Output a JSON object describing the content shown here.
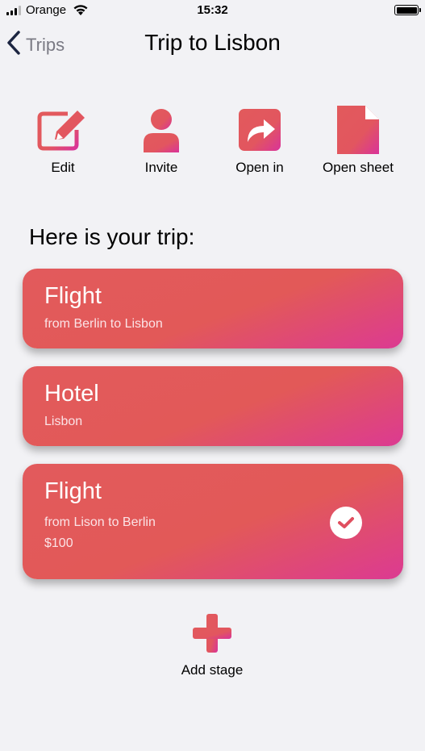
{
  "status_bar": {
    "carrier": "Orange",
    "time": "15:32"
  },
  "nav": {
    "back_label": "Trips",
    "title": "Trip to Lisbon"
  },
  "actions": [
    {
      "label": "Edit",
      "icon": "edit-icon"
    },
    {
      "label": "Invite",
      "icon": "person-icon"
    },
    {
      "label": "Open in",
      "icon": "share-icon"
    },
    {
      "label": "Open sheet",
      "icon": "document-icon"
    }
  ],
  "section_title": "Here is your trip:",
  "stages": [
    {
      "title": "Flight",
      "lines": [
        "from Berlin to Lisbon"
      ],
      "completed": false
    },
    {
      "title": "Hotel",
      "lines": [
        "Lisbon"
      ],
      "completed": false
    },
    {
      "title": "Flight",
      "lines": [
        "from Lison to Berlin",
        "$100"
      ],
      "completed": true
    }
  ],
  "add_stage_label": "Add stage",
  "colors": {
    "accent_start": "#e25a5c",
    "accent_end": "#dc3a92",
    "background": "#f2f2f5"
  }
}
